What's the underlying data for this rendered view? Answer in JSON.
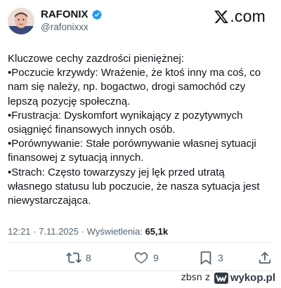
{
  "header": {
    "display_name": "RAFONIX",
    "handle": "@rafonixxx",
    "verified_icon": "verified-badge-icon",
    "site_logo_text": ".com",
    "site_logo_icon": "x-logo-icon"
  },
  "tweet": {
    "lines": [
      "Kluczowe cechy zazdrości pieniężnej:",
      "•Poczucie krzywdy: Wrażenie, że ktoś inny ma coś, co",
      "nam się należy, np. bogactwo, drogi samochód czy",
      "lepszą pozycję społeczną.",
      "•Frustracja: Dyskomfort wynikający z pozytywnych",
      "osiągnięć finansowych innych osób.",
      "•Porównywanie: Stałe porównywanie własnej sytuacji",
      "finansowej z sytuacją innych.",
      "•Strach: Często towarzyszy jej lęk przed utratą",
      "własnego statusu lub poczucie, że nasza sytuacja jest",
      "niewystarczająca."
    ]
  },
  "meta": {
    "time": "12:21",
    "date": "7.11.2025",
    "views_label": "Wyświetlenia:",
    "views_count": "65,1k"
  },
  "actions": {
    "retweets": "8",
    "likes": "9",
    "bookmarks": "3",
    "icons": [
      "retweet-icon",
      "like-icon",
      "bookmark-icon",
      "share-icon"
    ]
  },
  "footer": {
    "user_tag": "zbsn z",
    "brand": "wykop.pl"
  },
  "colors": {
    "verified_blue": "#1d9bf0",
    "secondary_text": "#536471",
    "primary_text": "#0f1419",
    "wykop_dark": "#2f3a45"
  }
}
